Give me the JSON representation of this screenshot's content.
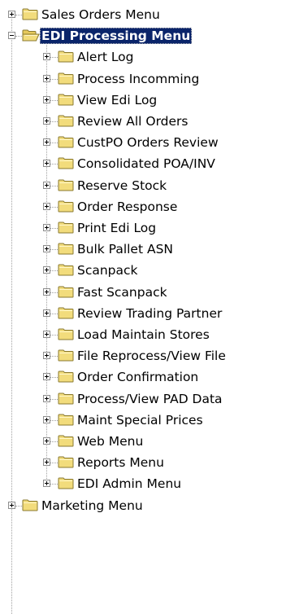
{
  "tree": {
    "top_items": [
      {
        "label": "Sales Orders Menu",
        "expanded": false
      },
      {
        "label": "EDI Processing Menu",
        "expanded": true,
        "selected": true
      },
      {
        "label": "Marketing Menu",
        "expanded": false
      }
    ],
    "children": [
      "Alert Log",
      "Process Incomming",
      "View Edi Log",
      "Review All Orders",
      "CustPO Orders Review",
      "Consolidated POA/INV",
      "Reserve Stock",
      "Order Response",
      "Print Edi Log",
      "Bulk Pallet ASN",
      "Scanpack",
      "Fast Scanpack",
      "Review Trading Partner",
      "Load Maintain Stores",
      "File Reprocess/View File",
      "Order Confirmation",
      "Process/View PAD Data",
      "Maint Special Prices",
      "Web Menu",
      "Reports Menu",
      "EDI Admin Menu"
    ]
  },
  "colors": {
    "selection_background": "#0a246a",
    "selection_text": "#ffffff",
    "folder_fill": "#f2dc7c",
    "folder_outline": "#8a7a30",
    "connector": "#a0a0a0"
  },
  "icons": {
    "folder": "folder-icon",
    "open_folder": "folder-open-icon",
    "expand": "plus-box-icon",
    "collapse": "minus-box-icon"
  }
}
